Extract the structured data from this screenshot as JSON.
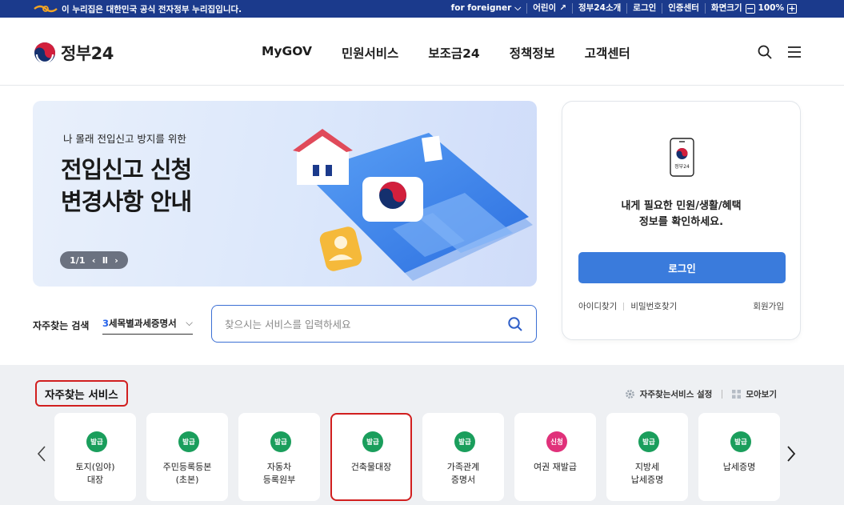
{
  "topbar": {
    "gov_notice": "이 누리집은 대한민국 공식 전자정부 누리집입니다.",
    "for_foreigner": "for foreigner",
    "kids": "어린이",
    "about": "정부24소개",
    "login": "로그인",
    "cert_center": "인증센터",
    "zoom_label": "화면크기",
    "zoom_value": "100%"
  },
  "header": {
    "logo_text": "정부24",
    "nav": [
      "MyGOV",
      "민원서비스",
      "보조금24",
      "정책정보",
      "고객센터"
    ]
  },
  "banner": {
    "eyebrow": "나 몰래 전입신고 방지를 위한",
    "headline_line1": "전입신고 신청",
    "headline_line2": "변경사항 안내",
    "pager": "1/1"
  },
  "login_card": {
    "phone_label": "정부24",
    "message_line1": "내게 필요한 민원/생활/혜택",
    "message_line2": "정보를 확인하세요.",
    "login_button": "로그인",
    "find_id": "아이디찾기",
    "find_pw": "비밀번호찾기",
    "join": "회원가입"
  },
  "search": {
    "label": "자주찾는 검색",
    "select_num": "3",
    "select_text": "세목별과세증명서",
    "placeholder": "찾으시는 서비스를 입력하세요"
  },
  "services": {
    "title": "자주찾는 서비스",
    "settings": "자주찾는서비스 설정",
    "view_all": "모아보기",
    "items": [
      {
        "badge": "발급",
        "label": "토지(임야)\n대장",
        "color": "#1a9e5c"
      },
      {
        "badge": "발급",
        "label": "주민등록등본\n(초본)",
        "color": "#1a9e5c"
      },
      {
        "badge": "발급",
        "label": "자동차\n등록원부",
        "color": "#1a9e5c"
      },
      {
        "badge": "발급",
        "label": "건축물대장",
        "color": "#1a9e5c"
      },
      {
        "badge": "발급",
        "label": "가족관계\n증명서",
        "color": "#1a9e5c"
      },
      {
        "badge": "신청",
        "label": "여권 재발급",
        "color": "#e0317a"
      },
      {
        "badge": "발급",
        "label": "지방세\n납세증명",
        "color": "#1a9e5c"
      },
      {
        "badge": "발급",
        "label": "납세증명",
        "color": "#1a9e5c"
      }
    ]
  },
  "colors": {
    "topbar": "#1b3a8c",
    "primary": "#3a7bdc",
    "highlight": "#d11f1f"
  }
}
